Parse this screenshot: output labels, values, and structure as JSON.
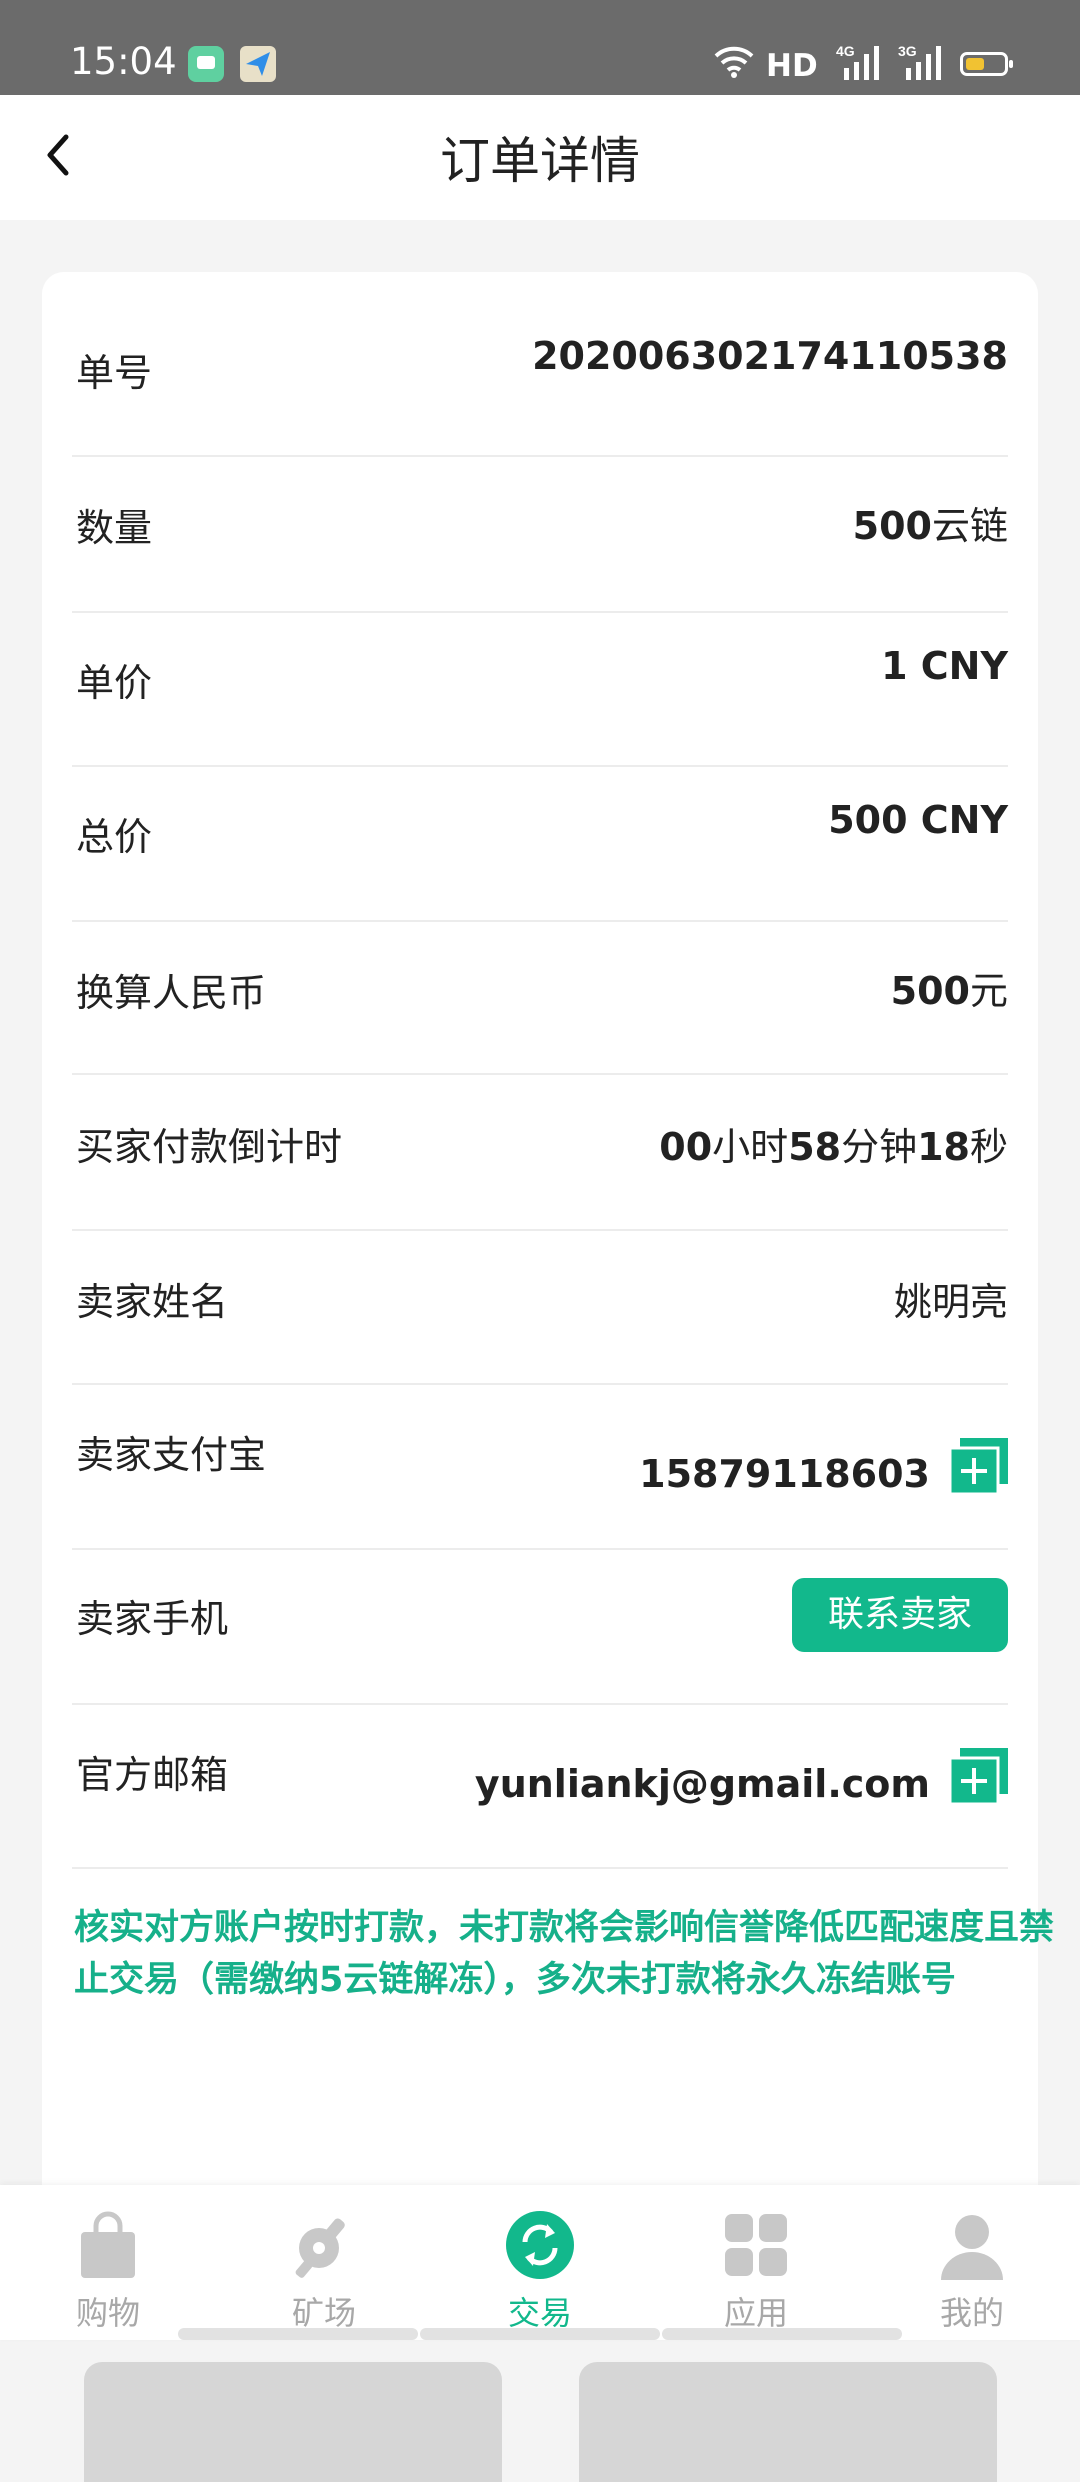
{
  "status_bar": {
    "time": "15:04",
    "network_badge": "HD",
    "signal1_label": "4G",
    "signal2_label": "3G"
  },
  "header": {
    "title": "订单详情"
  },
  "order": {
    "order_no_label": "单号",
    "order_no_value": "202006302174110538",
    "quantity_label": "数量",
    "quantity_value": "500",
    "quantity_unit": "云链",
    "unit_price_label": "单价",
    "unit_price_value": "1 CNY",
    "total_label": "总价",
    "total_value": "500 CNY",
    "rmb_label": "换算人民币",
    "rmb_value": "500",
    "rmb_unit": "元",
    "countdown_label": "买家付款倒计时",
    "countdown_hours": "00",
    "countdown_hours_unit": "小时",
    "countdown_minutes": "58",
    "countdown_minutes_unit": "分钟",
    "countdown_seconds": "18",
    "countdown_seconds_unit": "秒",
    "seller_name_label": "卖家姓名",
    "seller_name_value": "姚明亮",
    "seller_alipay_label": "卖家支付宝",
    "seller_alipay_value": "15879118603",
    "seller_phone_label": "卖家手机",
    "contact_seller_button": "联系卖家",
    "email_label": "官方邮箱",
    "email_value": "yunliankj@gmail.com"
  },
  "notice": "核实对方账户按时打款，未打款将会影响信誉降低匹配速度且禁止交易（需缴纳5云链解冻），多次未打款将永久冻结账号",
  "bottom_nav": [
    {
      "label": "购物",
      "icon": "shopping-bag-icon",
      "active": false
    },
    {
      "label": "矿场",
      "icon": "pickaxe-icon",
      "active": false
    },
    {
      "label": "交易",
      "icon": "exchange-icon",
      "active": true
    },
    {
      "label": "应用",
      "icon": "apps-grid-icon",
      "active": false
    },
    {
      "label": "我的",
      "icon": "user-icon",
      "active": false
    }
  ],
  "colors": {
    "accent": "#12b88c",
    "notice": "#16b08a",
    "status_bar": "#6b6b6b",
    "inactive_nav": "#a8a8a8"
  }
}
